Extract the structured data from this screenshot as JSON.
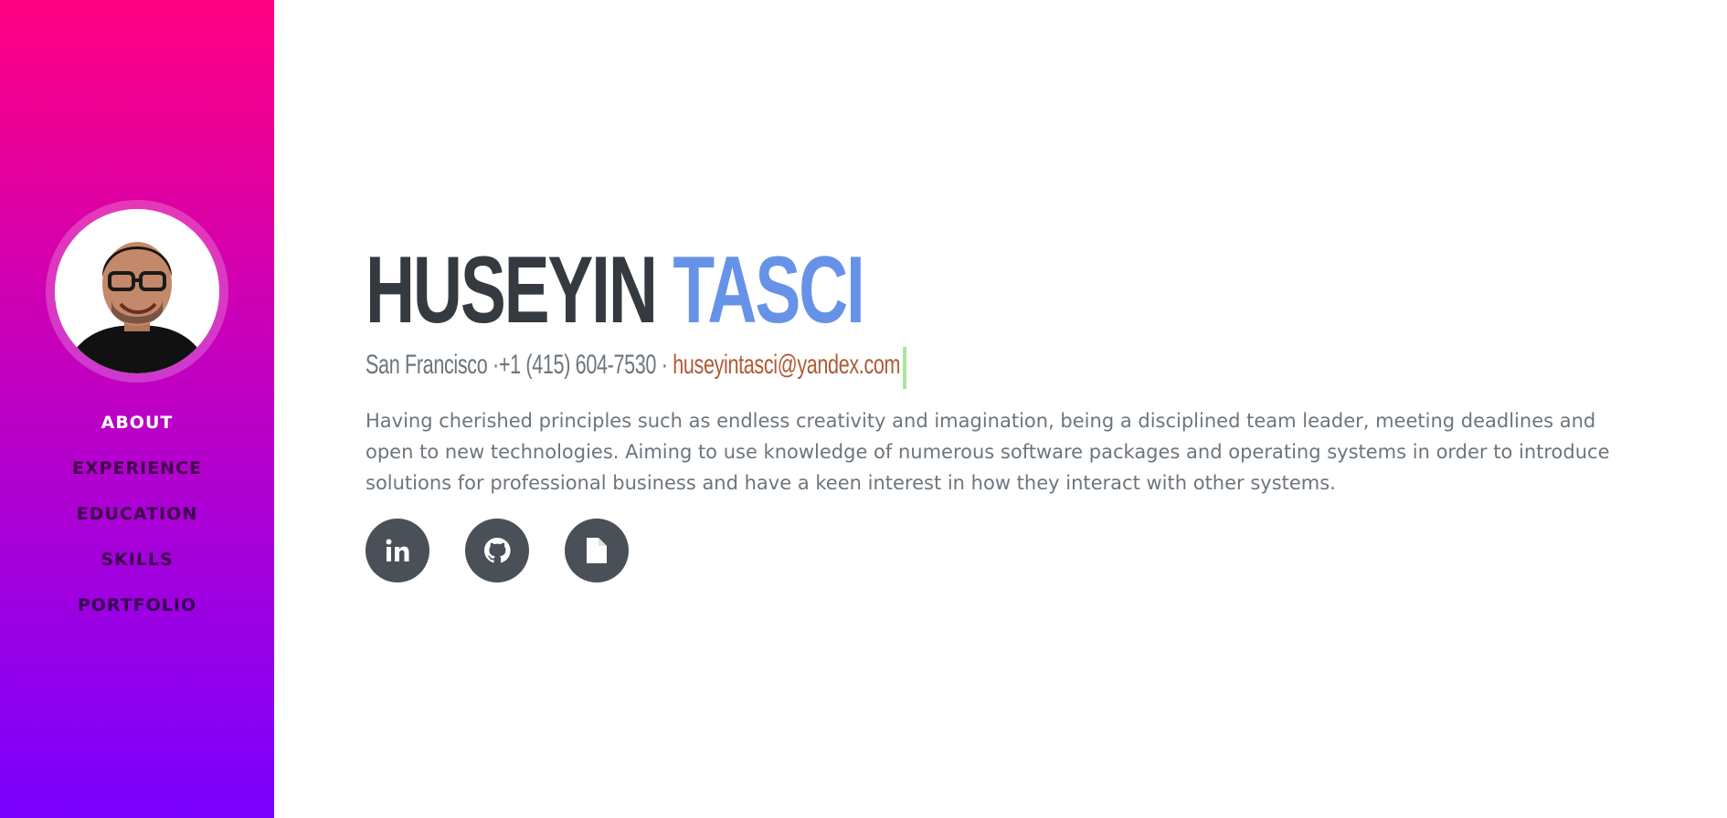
{
  "sidebar": {
    "avatar_alt": "Profile photo",
    "nav": [
      {
        "label": "ABOUT",
        "active": true
      },
      {
        "label": "EXPERIENCE",
        "active": false
      },
      {
        "label": "EDUCATION",
        "active": false
      },
      {
        "label": "SKILLS",
        "active": false
      },
      {
        "label": "PORTFOLIO",
        "active": false
      }
    ],
    "gradient_top": "#ff0080",
    "gradient_bottom": "#7a00ff"
  },
  "header": {
    "first_name": "HUSEYIN",
    "last_name": "TASCI",
    "last_name_color": "#6693e8"
  },
  "contact": {
    "city": "San Francisco",
    "separator_1": " ·",
    "phone": "+1 (415) 604-7530",
    "separator_2": " · ",
    "email": "huseyintasci@yandex.com",
    "email_color": "#b05a36"
  },
  "about": {
    "text": "Having cherished principles such as endless creativity and imagination, being a disciplined team leader, meeting deadlines and open to new technologies. Aiming to use knowledge of numerous software packages and operating systems in order to introduce solutions for professional business and have a keen interest in how they interact with other systems."
  },
  "social": [
    {
      "icon": "linkedin-icon"
    },
    {
      "icon": "github-icon"
    },
    {
      "icon": "file-icon"
    }
  ]
}
